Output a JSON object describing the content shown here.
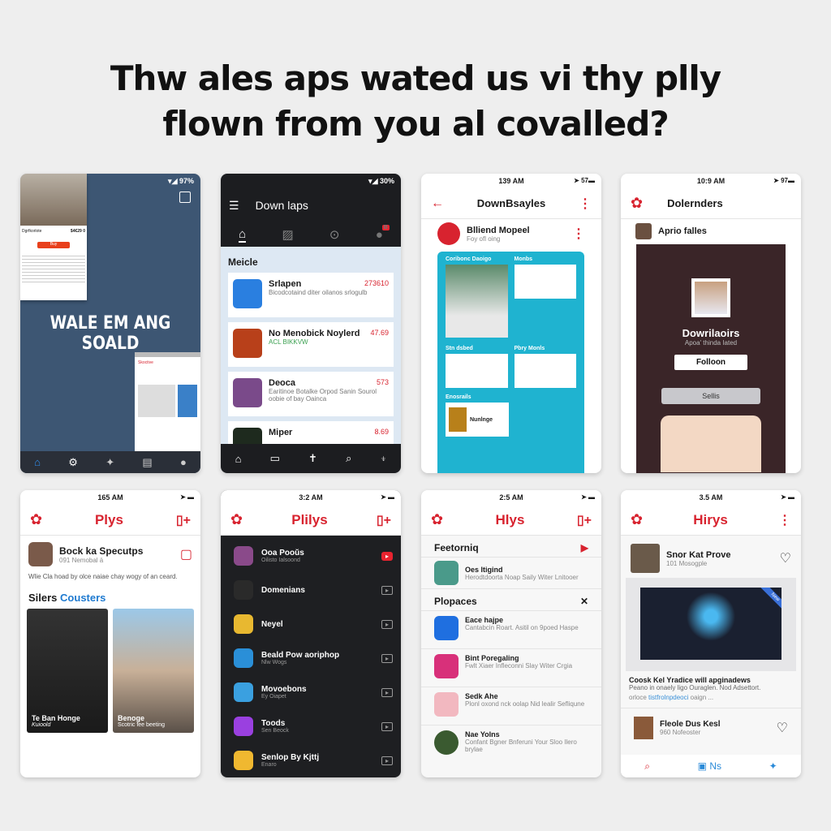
{
  "headline": {
    "line1": "Thw ales aps wated us vi thy plly",
    "line2": "flown from you al covalled?"
  },
  "p1": {
    "status": "▾◢ 97%",
    "banner": [
      "WALE EM ANG",
      "SOALD"
    ],
    "card_title": "Dgrfkorlote",
    "card_price": "$4€29 0",
    "card_btn": "Buy",
    "popup_title": "Skoctive",
    "nav": [
      "home-icon",
      "gear-icon",
      "twitter-icon",
      "book-icon",
      "person-icon"
    ]
  },
  "p2": {
    "status": "▾◢ 30%",
    "title": "Down laps",
    "section": "Meicle",
    "items": [
      {
        "name": "Srlapen",
        "price": "273610",
        "desc": "Bicodcotaind diter oilanos srlogulb",
        "icon": "#2a7fe0"
      },
      {
        "name": "No Menobick Noylerd",
        "price": "47.69",
        "desc": "ACL BIKKVW",
        "icon": "#b8401a"
      },
      {
        "name": "Deoca",
        "price": "573",
        "desc": "Earitinoe Botalke Orpod Sanin Sourol oobie of bay Oainca",
        "icon": "#7a4a8a"
      },
      {
        "name": "Miper",
        "price": "8.69",
        "desc": "",
        "icon": "#1e2a1e"
      }
    ],
    "badge": "B"
  },
  "p3": {
    "time": "139 AM",
    "status": "➤ 57▬",
    "title": "DownBsayles",
    "sub_title": "Blliend Mopeel",
    "sub_desc": "Foy ofl oing",
    "sections": [
      "Coribonc Daoigo",
      "Monbs",
      "Stn dsbed",
      "Pbry Monls",
      "Enosrails"
    ],
    "card_label": "Nunlnge",
    "accent": "#1fb3d0"
  },
  "p4": {
    "time": "10:9 AM",
    "status": "➤ 97▬",
    "title": "Dolernders",
    "row": "Aprio falles",
    "name": "Dowrilaoirs",
    "sub": "Apoa' thinda Iated",
    "follow": "Folloon",
    "settings": "Sellis"
  },
  "p5": {
    "time": "165 AM",
    "title": "Plys",
    "post_title": "Bock ka Specutps",
    "post_meta": "091 Nemobal ä",
    "post_text": "Wlie Cla hoad by olce naiae chay wogy of an ceard.",
    "section_a": "Silers",
    "section_b": "Cousters",
    "cards": [
      {
        "title": "Te Ban Honge",
        "sub": "Kuioold"
      },
      {
        "title": "Benoge",
        "sub": "Scotric fee beeting"
      }
    ]
  },
  "p6": {
    "time": "3:2 AM",
    "title": "Plilys",
    "items": [
      {
        "name": "Ooa Pooŭs",
        "sub": "Oilisto Ialsoond",
        "icon": "#8a4a8a"
      },
      {
        "name": "Domenians",
        "sub": "",
        "icon": "#2a2a2a"
      },
      {
        "name": "Neyel",
        "sub": "",
        "icon": "#e8b830"
      },
      {
        "name": "Beald Pow aoriphop",
        "sub": "Nlw Wogs",
        "icon": "#2a8fd8"
      },
      {
        "name": "Movoebons",
        "sub": "Ey Oiapet",
        "icon": "#3aa0e0"
      },
      {
        "name": "Toods",
        "sub": "Sen Beock",
        "icon": "#9a40e0"
      },
      {
        "name": "Senlop By Kjttj",
        "sub": "Enaro",
        "icon": "#f0b830"
      }
    ]
  },
  "p7": {
    "time": "2:5 AM",
    "title": "Hlys",
    "featured": "Feetorniq",
    "featured_item": {
      "name": "Oes Itigind",
      "desc": "Herodtdoorta Noap Saily Witer Lnitooer"
    },
    "section": "Plopaces",
    "items": [
      {
        "name": "Eace hajpe",
        "desc": "Cantabcin Roart. Asitil on 9poed Haspe",
        "icon": "#1f6fe0"
      },
      {
        "name": "Bint Poregaling",
        "desc": "Fwlt Xiaer Infleconni Slay Witer Crgia",
        "icon": "#d8307a"
      },
      {
        "name": "Sedk Ahe",
        "desc": "Plonl oxond nck oolap Nid lealir Sefliqune",
        "icon": "#f2b8c0"
      },
      {
        "name": "Nae Yolns",
        "desc": "Confant Bgner Bnferuni Your Sloo Ilero brylae",
        "icon": "#3a5a30"
      }
    ]
  },
  "p8": {
    "time": "3.5 AM",
    "title": "Hirys",
    "item1": {
      "name": "Snor Kat Prove",
      "sub": "101 Mosogple"
    },
    "article_title": "Coosk Kel Yradice will apginadews",
    "article_text": "Peano in onaely ligo Ouraglen. Nod Adsettort.",
    "article_more": "orloce",
    "article_link": "tistfrolnpdeoci",
    "article_end": "oaign ...",
    "ribbon": "New",
    "item2": {
      "name": "Fleole Dus Kesl",
      "sub": "960 Nofeoster"
    },
    "nav": {
      "search": "search-icon",
      "mid": "Ns",
      "right": "bird-icon"
    }
  }
}
